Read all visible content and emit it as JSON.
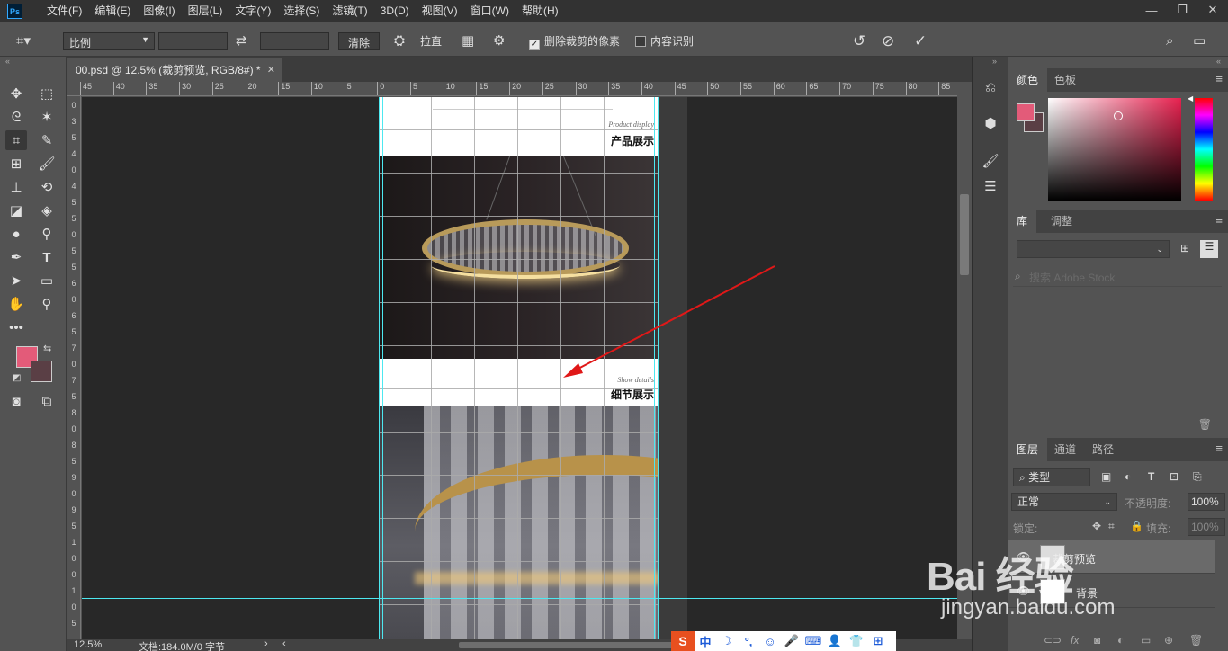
{
  "menubar": {
    "app_logo": "Ps",
    "items": [
      "文件(F)",
      "编辑(E)",
      "图像(I)",
      "图层(L)",
      "文字(Y)",
      "选择(S)",
      "滤镜(T)",
      "3D(D)",
      "视图(V)",
      "窗口(W)",
      "帮助(H)"
    ]
  },
  "window_controls": {
    "minimize": "—",
    "restore": "❐",
    "close": "✕"
  },
  "options_bar": {
    "ratio_select": "比例",
    "clear_button": "清除",
    "straighten_label": "拉直",
    "delete_cropped_label": "删除裁剪的像素",
    "delete_cropped_checked": true,
    "content_aware_label": "内容识别",
    "content_aware_checked": false
  },
  "document": {
    "tab_title": "00.psd @ 12.5% (裁剪预览, RGB/8#) *",
    "heading1_en": "Product display",
    "heading1_cn": "产品展示",
    "heading2_en": "Show details",
    "heading2_cn": "细节展示"
  },
  "ruler_h_labels": [
    "45",
    "40",
    "35",
    "30",
    "25",
    "20",
    "15",
    "10",
    "5",
    "0",
    "5",
    "10",
    "15",
    "20",
    "25",
    "30",
    "35",
    "40",
    "45",
    "50",
    "55",
    "60",
    "65",
    "70",
    "75",
    "80",
    "85"
  ],
  "ruler_v_labels": [
    "0",
    "3",
    "5",
    "4",
    "0",
    "4",
    "5",
    "5",
    "0",
    "5",
    "5",
    "6",
    "0",
    "6",
    "5",
    "7",
    "0",
    "7",
    "5",
    "8",
    "0",
    "8",
    "5",
    "9",
    "0",
    "9",
    "5",
    "1",
    "0",
    "0",
    "1",
    "0",
    "5"
  ],
  "status_bar": {
    "zoom": "12.5%",
    "doc_info": "文档:184.0M/0 字节"
  },
  "color_panel": {
    "tabs": [
      "颜色",
      "色板"
    ],
    "foreground": "#e35b79",
    "background": "#5a3f45"
  },
  "library_panel": {
    "tabs": [
      "库",
      "调整"
    ],
    "search_placeholder": "搜索 Adobe Stock"
  },
  "layers_panel": {
    "tabs": [
      "图层",
      "通道",
      "路径"
    ],
    "filter_type": "类型",
    "blend_mode": "正常",
    "opacity_label": "不透明度:",
    "opacity_value": "100%",
    "lock_label": "锁定:",
    "fill_label": "填充:",
    "fill_value": "100%",
    "layers": [
      {
        "name": "裁剪预览"
      },
      {
        "name": "背景"
      }
    ]
  },
  "ime_bar": {
    "logo": "S",
    "lang": "中",
    "items": [
      "中",
      "☽",
      "°,",
      "☺",
      "🎤",
      "⌨",
      "👤",
      "👕",
      "⊞"
    ]
  },
  "watermark": {
    "text": "Bai 经验",
    "url": "jingyan.baidu.com"
  }
}
